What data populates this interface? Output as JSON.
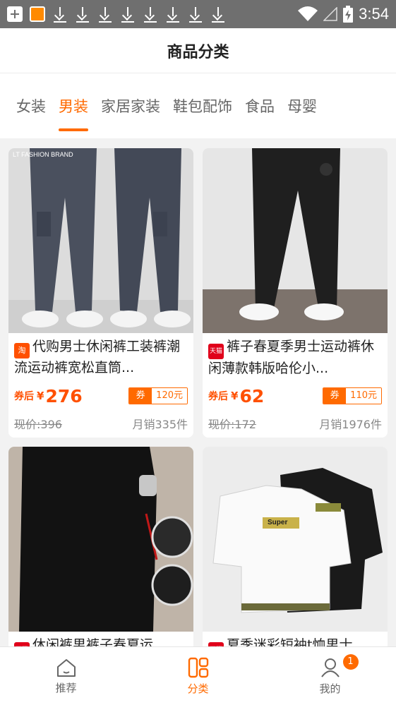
{
  "status_bar": {
    "time": "3:54"
  },
  "header": {
    "title": "商品分类"
  },
  "tabs": [
    {
      "label": "女装"
    },
    {
      "label": "男装"
    },
    {
      "label": "家居家装"
    },
    {
      "label": "鞋包配饰"
    },
    {
      "label": "食品"
    },
    {
      "label": "母婴"
    }
  ],
  "active_tab": "男装",
  "products": [
    {
      "platform": "淘",
      "title": "代购男士休闲裤工装裤潮流运动裤宽松直筒...",
      "after_label": "券后",
      "currency": "¥",
      "price": "276",
      "coupon_tag": "券",
      "coupon_value": "120元",
      "orig_price": "现价:396",
      "sales": "月销335件",
      "image_text": "LT FASHION BRAND"
    },
    {
      "platform": "天猫",
      "title": "裤子春夏季男士运动裤休闲薄款韩版哈伦小...",
      "after_label": "券后",
      "currency": "¥",
      "price": "62",
      "coupon_tag": "券",
      "coupon_value": "110元",
      "orig_price": "现价:172",
      "sales": "月销1976件"
    },
    {
      "platform": "天猫",
      "title": "休闲裤男裤子春夏运..."
    },
    {
      "platform": "天猫",
      "title": "夏季迷彩短袖t恤男士...",
      "image_text": "Super"
    }
  ],
  "bottom_nav": [
    {
      "label": "推荐",
      "icon": "home-icon"
    },
    {
      "label": "分类",
      "icon": "category-icon"
    },
    {
      "label": "我的",
      "icon": "user-icon",
      "badge": "1"
    }
  ],
  "colors": {
    "accent": "#ff6a00",
    "price": "#ff5000"
  }
}
